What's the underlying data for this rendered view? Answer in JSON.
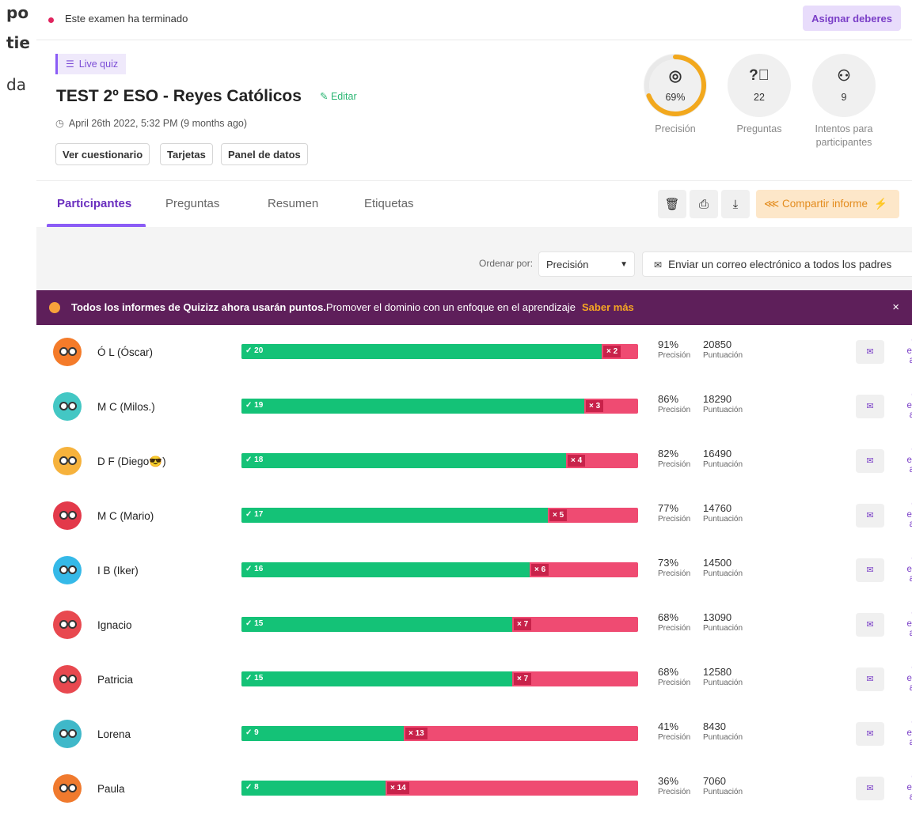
{
  "background": {
    "fragments": [
      "po",
      "tie",
      "da"
    ]
  },
  "status": {
    "text": "Este examen ha terminado",
    "assign_label": "Asignar deberes"
  },
  "header": {
    "quiz_type": "Live quiz",
    "title": "TEST 2º ESO - Reyes Católicos",
    "edit_label": "Editar",
    "date": "April 26th 2022, 5:32 PM (9 months ago)",
    "buttons": [
      "Ver cuestionario",
      "Tarjetas",
      "Panel de datos"
    ]
  },
  "stats": [
    {
      "icon": "target-icon",
      "value": "69%",
      "label": "Precisión",
      "ring_fraction": 0.69
    },
    {
      "icon": "question-icon",
      "value": "22",
      "label": "Preguntas"
    },
    {
      "icon": "users-icon",
      "value": "9",
      "label": "Intentos para participantes"
    }
  ],
  "tabs": [
    "Participantes",
    "Preguntas",
    "Resumen",
    "Etiquetas"
  ],
  "share_label": "Compartir informe",
  "sort": {
    "label": "Ordenar por:",
    "value": "Precisión"
  },
  "mail_all_label": "Enviar un correo electrónico a todos los padres",
  "banner": {
    "bold": "Todos los informes de Quizizz ahora usarán puntos.",
    "text": "Promover el dominio con un enfoque en el aprendizaje",
    "link": "Saber más",
    "close": "×"
  },
  "metric_labels": {
    "accuracy": "Precisión",
    "score": "Puntuación"
  },
  "mail_parent_lines": [
    "Corre",
    "electró",
    "al pad"
  ],
  "participants": [
    {
      "name": "Ó L (Óscar)",
      "correct": 20,
      "wrong": 2,
      "correct_label": "✓ 20",
      "wrong_label": "× 2",
      "accuracy": "91%",
      "score": "20850",
      "color": "#f47b2a"
    },
    {
      "name": "M C (Milos.)",
      "correct": 19,
      "wrong": 3,
      "correct_label": "✓ 19",
      "wrong_label": "× 3",
      "accuracy": "86%",
      "score": "18290",
      "color": "#43c7c4"
    },
    {
      "name": "D F (Diego😎)",
      "correct": 18,
      "wrong": 4,
      "correct_label": "✓ 18",
      "wrong_label": "× 4",
      "accuracy": "82%",
      "score": "16490",
      "color": "#f6b23c"
    },
    {
      "name": "M C (Mario)",
      "correct": 17,
      "wrong": 5,
      "correct_label": "✓ 17",
      "wrong_label": "× 5",
      "accuracy": "77%",
      "score": "14760",
      "color": "#e3394a"
    },
    {
      "name": "I B (Iker)",
      "correct": 16,
      "wrong": 6,
      "correct_label": "✓ 16",
      "wrong_label": "× 6",
      "accuracy": "73%",
      "score": "14500",
      "color": "#35b9e8"
    },
    {
      "name": "Ignacio",
      "correct": 15,
      "wrong": 7,
      "correct_label": "✓ 15",
      "wrong_label": "× 7",
      "accuracy": "68%",
      "score": "13090",
      "color": "#e8484f"
    },
    {
      "name": "Patricia",
      "correct": 15,
      "wrong": 7,
      "correct_label": "✓ 15",
      "wrong_label": "× 7",
      "accuracy": "68%",
      "score": "12580",
      "color": "#e8484f"
    },
    {
      "name": "Lorena",
      "correct": 9,
      "wrong": 13,
      "correct_label": "✓ 9",
      "wrong_label": "× 13",
      "accuracy": "41%",
      "score": "8430",
      "color": "#3fb8c9"
    },
    {
      "name": "Paula",
      "correct": 8,
      "wrong": 14,
      "correct_label": "✓ 8",
      "wrong_label": "× 14",
      "accuracy": "36%",
      "score": "7060",
      "color": "#f07a2e"
    }
  ]
}
